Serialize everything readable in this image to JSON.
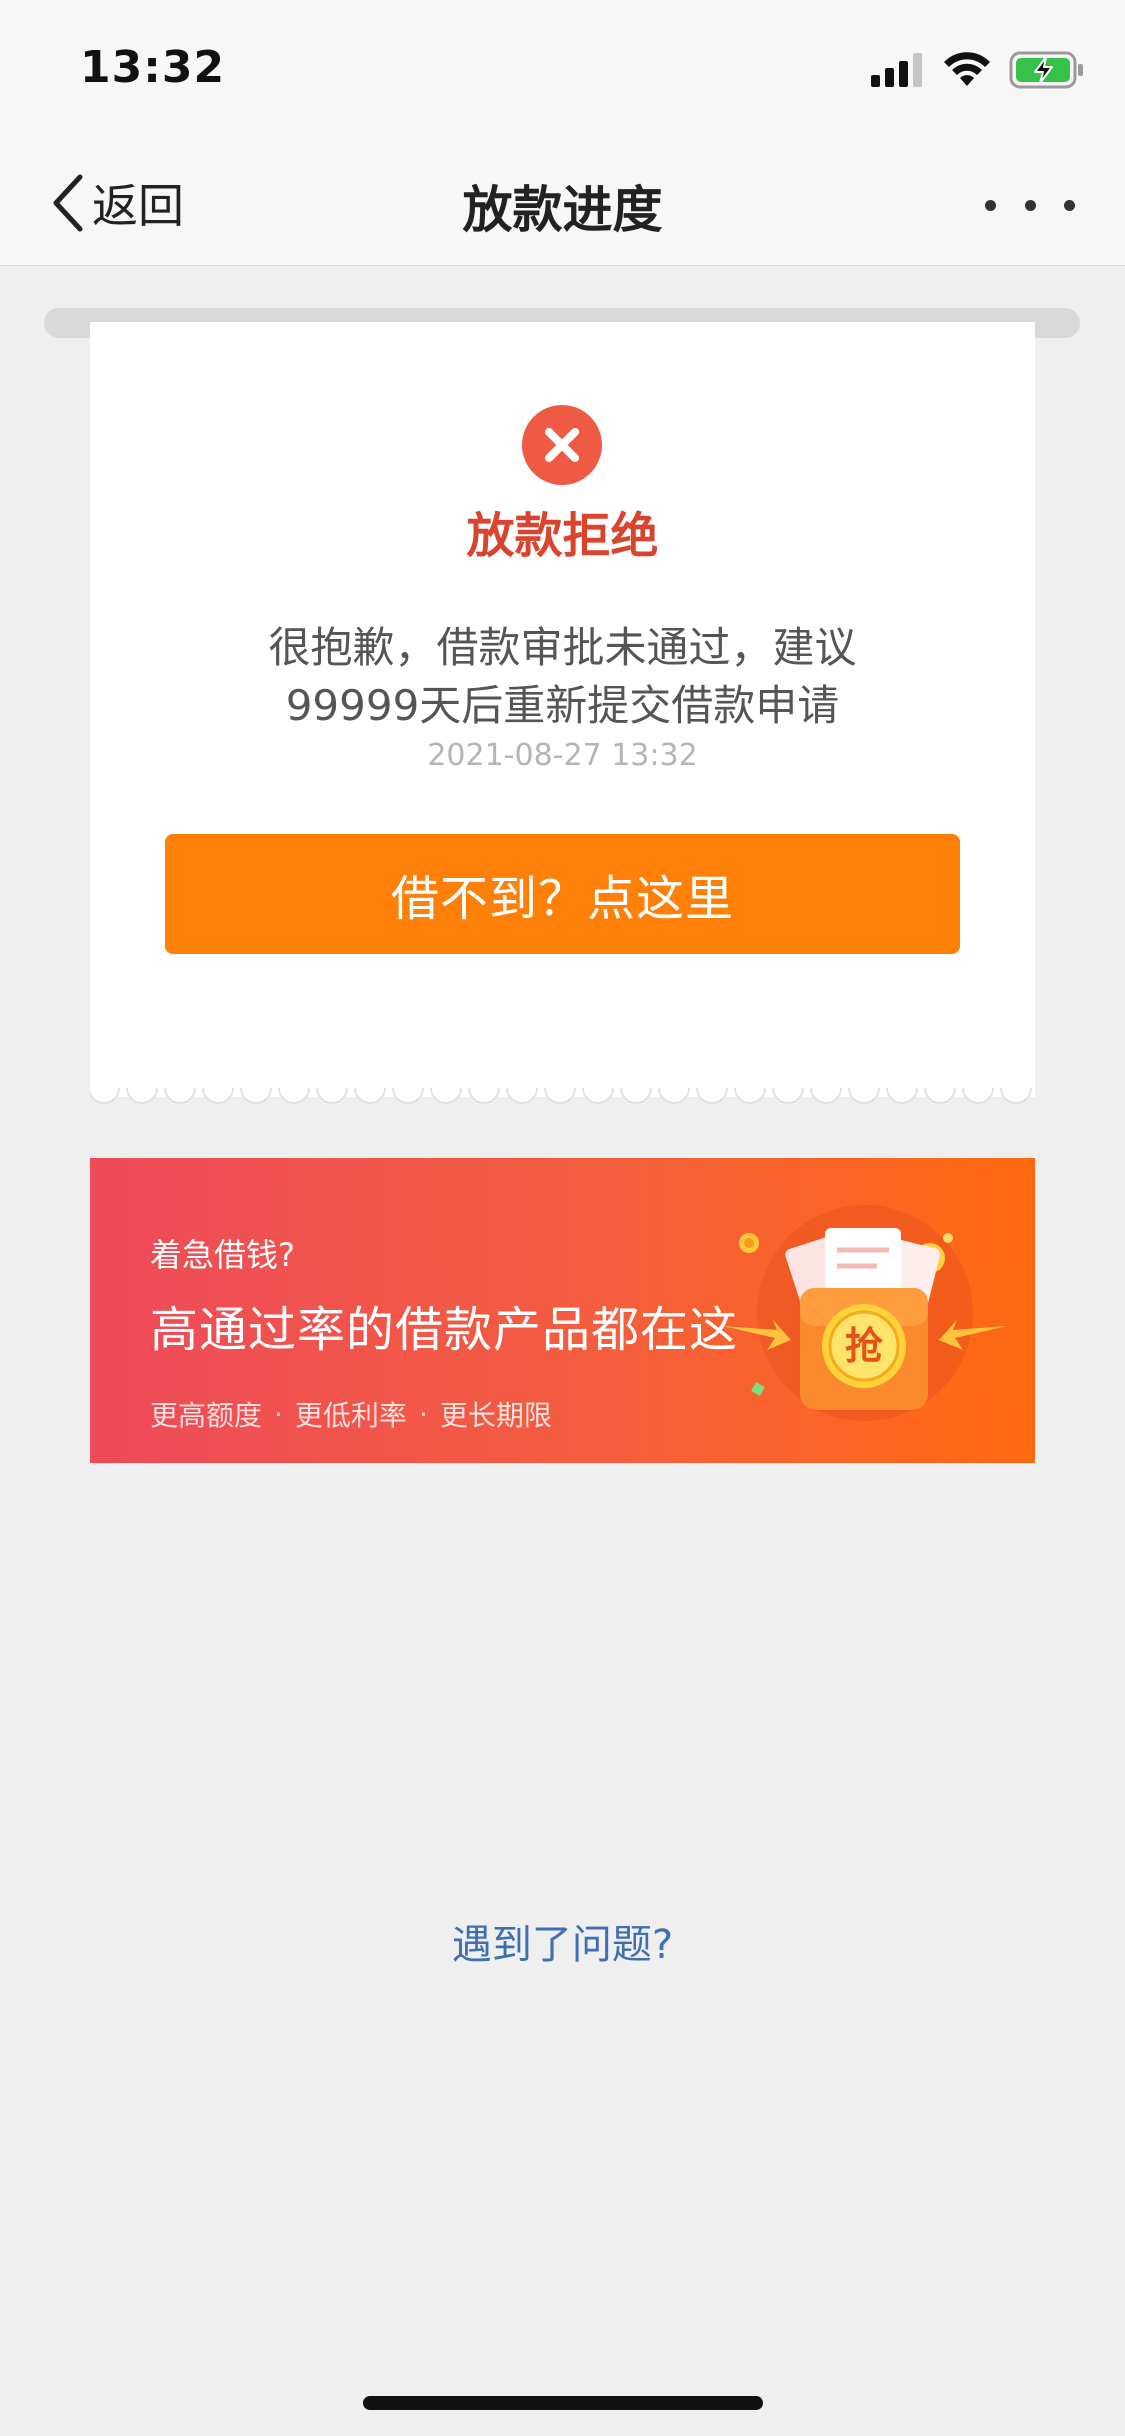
{
  "status_bar": {
    "time": "13:32"
  },
  "nav": {
    "back_label": "返回",
    "title": "放款进度"
  },
  "result": {
    "status_title": "放款拒绝",
    "message_line1": "很抱歉，借款审批未通过，建议",
    "message_line2": "99999天后重新提交借款申请",
    "timestamp": "2021-08-27 13:32",
    "action_label": "借不到？点这里"
  },
  "banner": {
    "kicker": "着急借钱?",
    "headline": "高通过率的借款产品都在这",
    "features": [
      "更高额度",
      "更低利率",
      "更长期限"
    ],
    "separator": "·",
    "badge_char": "抢"
  },
  "help": {
    "label": "遇到了问题?"
  },
  "colors": {
    "status_red": "#ef5a45",
    "status_text": "#d9442e",
    "action_orange": "#ff8008",
    "link_blue": "#3f6fb0",
    "battery_green": "#36c24a"
  },
  "icons": {
    "status": "close-circle-icon",
    "back": "chevron-left-icon",
    "more": "more-dots-icon",
    "signal": "cellular-signal-icon",
    "wifi": "wifi-icon",
    "battery": "battery-charging-icon"
  }
}
